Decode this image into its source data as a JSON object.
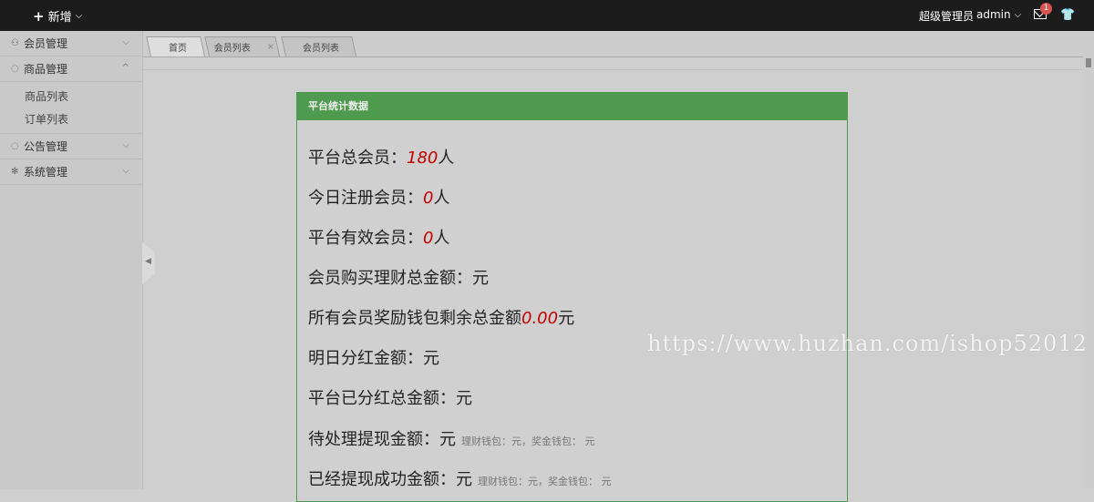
{
  "topbar": {
    "add_label": "新增",
    "role": "超级管理员",
    "username": "admin",
    "mail_count": "1"
  },
  "sidebar": {
    "items": [
      {
        "label": "会员管理",
        "icon": "user-icon"
      },
      {
        "label": "商品管理",
        "icon": "comment-icon"
      },
      {
        "label": "公告管理",
        "icon": "comment-icon"
      },
      {
        "label": "系统管理",
        "icon": "gear-icon"
      }
    ],
    "subitems": [
      "商品列表",
      "订单列表"
    ]
  },
  "tabs": [
    {
      "label": "首页"
    },
    {
      "label": "会员列表",
      "close": "×"
    },
    {
      "label": "会员列表",
      "close": "×"
    }
  ],
  "panel": {
    "title": "平台统计数据",
    "stats": [
      {
        "label": "平台总会员：",
        "value": "180",
        "unit": "人"
      },
      {
        "label": "今日注册会员：",
        "value": "0",
        "unit": "人"
      },
      {
        "label": "平台有效会员：",
        "value": "0",
        "unit": "人"
      },
      {
        "label": "会员购买理财总金额：元"
      },
      {
        "label": "所有会员奖励钱包剩余总金额",
        "value": "0.00",
        "unit": "元"
      },
      {
        "label": "明日分红金额：元"
      },
      {
        "label": "平台已分红总金额：元"
      },
      {
        "label": "待处理提现金额：元",
        "sub": "理财钱包：元，奖金钱包： 元"
      },
      {
        "label": "已经提现成功金额：元",
        "sub": "理财钱包：元，奖金钱包： 元"
      }
    ]
  },
  "watermark": "https://www.huzhan.com/ishop52012",
  "colors": {
    "accent": "#4e9a4e",
    "value": "#c40000",
    "topbar": "#1c1c1c"
  }
}
